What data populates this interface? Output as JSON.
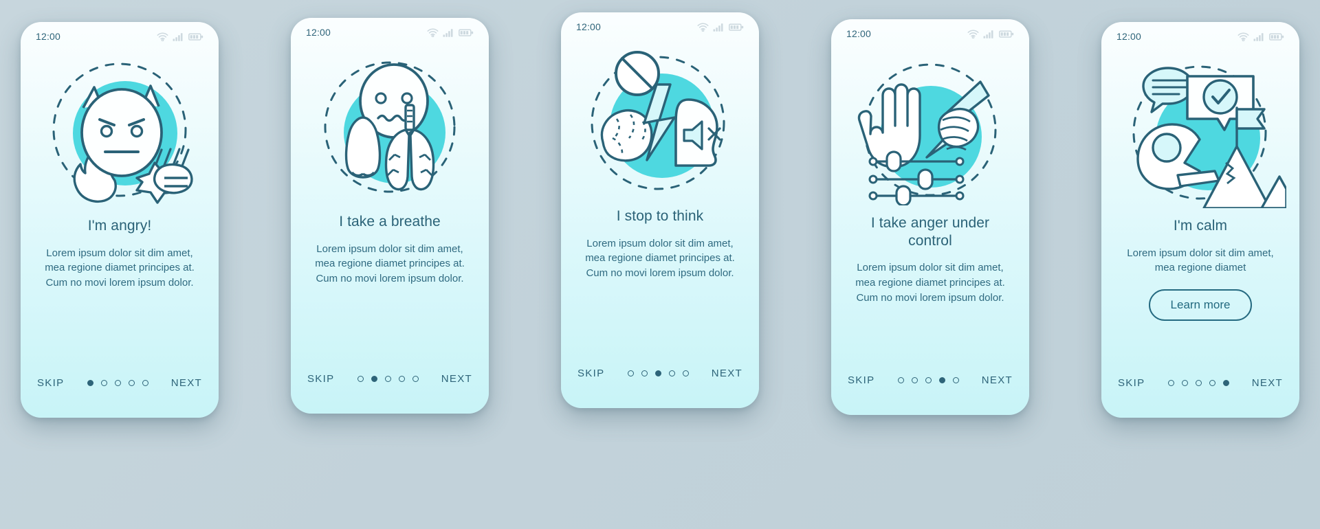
{
  "theme": {
    "page_background": "#c3d3db",
    "screen_gradient_top": "#fbfeff",
    "screen_gradient_bottom": "#c8f4f7",
    "accent_teal": "#4ed8e0",
    "ink": "#2a6277",
    "muted_icon": "#cdd9df"
  },
  "statusbar": {
    "time": "12:00",
    "icons": [
      "wifi-icon",
      "signal-icon",
      "battery-icon"
    ]
  },
  "nav": {
    "skip_label": "SKIP",
    "next_label": "NEXT",
    "dot_count": 5
  },
  "screens": [
    {
      "id": "screen-angry",
      "illustration": "angry-devil-face-flame-fist",
      "title": "I'm angry!",
      "description": "Lorem ipsum dolor sit dim amet, mea regione diamet principes at. Cum no movi lorem ipsum dolor.",
      "active_dot": 1,
      "has_learn_more": false,
      "learn_more_label": ""
    },
    {
      "id": "screen-breathe",
      "illustration": "face-nose-lungs",
      "title": "I take a breathe",
      "description": "Lorem ipsum dolor sit dim amet, mea regione diamet principes at. Cum no movi lorem ipsum dolor.",
      "active_dot": 2,
      "has_learn_more": false,
      "learn_more_label": ""
    },
    {
      "id": "screen-stop-to-think",
      "illustration": "prohibition-brain-lightning-head-mute",
      "title": "I stop to think",
      "description": "Lorem ipsum dolor sit dim amet, mea regione diamet principes at. Cum no movi lorem ipsum dolor.",
      "active_dot": 3,
      "has_learn_more": false,
      "learn_more_label": ""
    },
    {
      "id": "screen-anger-under-control",
      "illustration": "stop-hand-fist-lightning-sliders",
      "title": "I take anger under control",
      "description": "Lorem ipsum dolor sit dim amet, mea regione diamet principes at. Cum no movi lorem ipsum dolor.",
      "active_dot": 4,
      "has_learn_more": false,
      "learn_more_label": ""
    },
    {
      "id": "screen-calm",
      "illustration": "chat-check-meditation-mountain-flag",
      "title": "I'm calm",
      "description": "Lorem ipsum dolor sit dim amet, mea regione diamet",
      "active_dot": 5,
      "has_learn_more": true,
      "learn_more_label": "Learn more"
    }
  ]
}
